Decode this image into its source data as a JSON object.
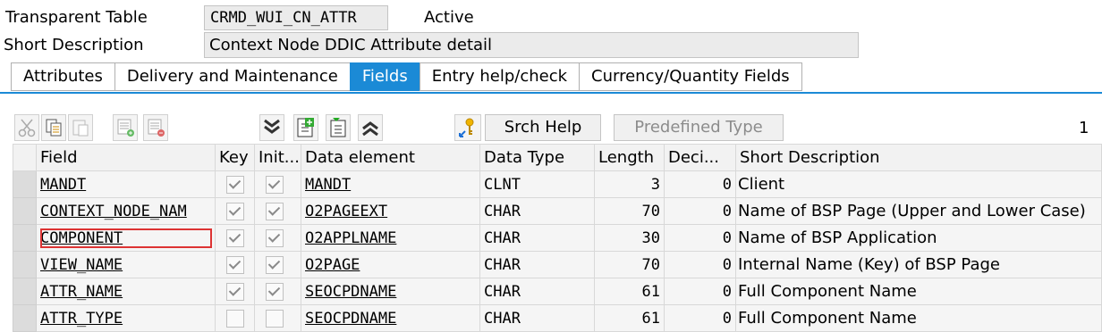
{
  "header": {
    "table_type_label": "Transparent Table",
    "table_name": "CRMD_WUI_CN_ATTR",
    "status": "Active",
    "short_desc_label": "Short Description",
    "short_desc_value": "Context Node DDIC Attribute detail"
  },
  "tabs": [
    {
      "label": "Attributes",
      "active": false
    },
    {
      "label": "Delivery and Maintenance",
      "active": false
    },
    {
      "label": "Fields",
      "active": true
    },
    {
      "label": "Entry help/check",
      "active": false
    },
    {
      "label": "Currency/Quantity Fields",
      "active": false
    }
  ],
  "toolbar": {
    "icons": [
      "cut-icon",
      "copy-icon",
      "paste-icon",
      "insert-row-icon",
      "delete-row-icon",
      "expand-all-icon",
      "insert-field-icon",
      "select-icon",
      "collapse-all-icon",
      "search-help-key-icon"
    ],
    "search_help_label": "Srch Help",
    "predefined_type_label": "Predefined Type",
    "page_number": "1"
  },
  "columns": [
    "Field",
    "Key",
    "Init...",
    "Data element",
    "Data Type",
    "Length",
    "Deci...",
    "Short Description"
  ],
  "rows": [
    {
      "field": "MANDT",
      "key": true,
      "init": true,
      "data_element": "MANDT",
      "data_type": "CLNT",
      "length": "3",
      "decimals": "0",
      "description": "Client"
    },
    {
      "field": "CONTEXT_NODE_NAM",
      "key": true,
      "init": true,
      "data_element": "O2PAGEEXT",
      "data_type": "CHAR",
      "length": "70",
      "decimals": "0",
      "description": "Name of BSP Page (Upper and Lower Case)"
    },
    {
      "field": "COMPONENT",
      "key": true,
      "init": true,
      "data_element": "O2APPLNAME",
      "data_type": "CHAR",
      "length": "30",
      "decimals": "0",
      "description": "Name of BSP Application"
    },
    {
      "field": "VIEW_NAME",
      "key": true,
      "init": true,
      "data_element": "O2PAGE",
      "data_type": "CHAR",
      "length": "70",
      "decimals": "0",
      "description": "Internal Name (Key) of BSP Page"
    },
    {
      "field": "ATTR_NAME",
      "key": true,
      "init": true,
      "data_element": "SEOCPDNAME",
      "data_type": "CHAR",
      "length": "61",
      "decimals": "0",
      "description": "Full Component Name"
    },
    {
      "field": "ATTR_TYPE",
      "key": false,
      "init": false,
      "data_element": "SEOCPDNAME",
      "data_type": "CHAR",
      "length": "61",
      "decimals": "0",
      "description": "Full Component Name"
    }
  ]
}
